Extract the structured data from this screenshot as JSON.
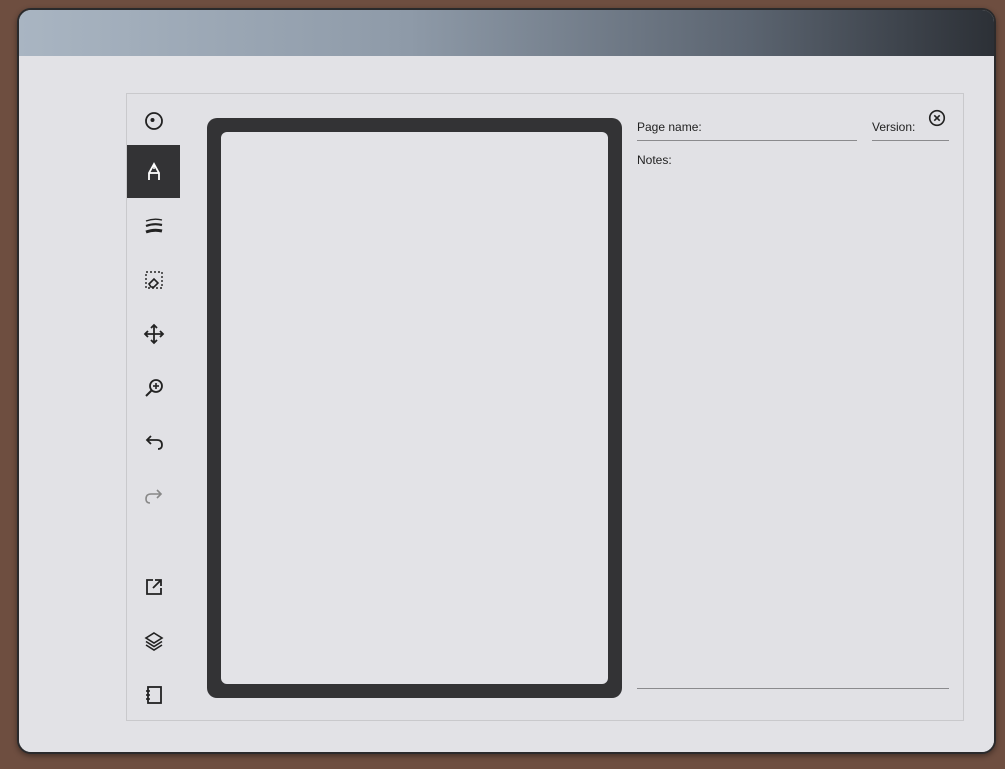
{
  "toolbar": {
    "items": [
      {
        "name": "compass-icon",
        "active": false
      },
      {
        "name": "pen-icon",
        "active": true
      },
      {
        "name": "stroke-width-icon",
        "active": false
      },
      {
        "name": "selection-eraser-icon",
        "active": false
      },
      {
        "name": "move-icon",
        "active": false
      },
      {
        "name": "zoom-icon",
        "active": false
      },
      {
        "name": "undo-icon",
        "active": false
      },
      {
        "name": "redo-icon",
        "active": false
      },
      {
        "name": "export-icon",
        "active": false
      },
      {
        "name": "layers-icon",
        "active": false
      },
      {
        "name": "notebook-icon",
        "active": false
      }
    ]
  },
  "details": {
    "page_name_label": "Page name:",
    "page_name_value": "",
    "version_label": "Version:",
    "version_value": "",
    "notes_label": "Notes:",
    "notes_value": ""
  },
  "colors": {
    "accent_dark": "#333335",
    "background": "#e1e1e5"
  }
}
